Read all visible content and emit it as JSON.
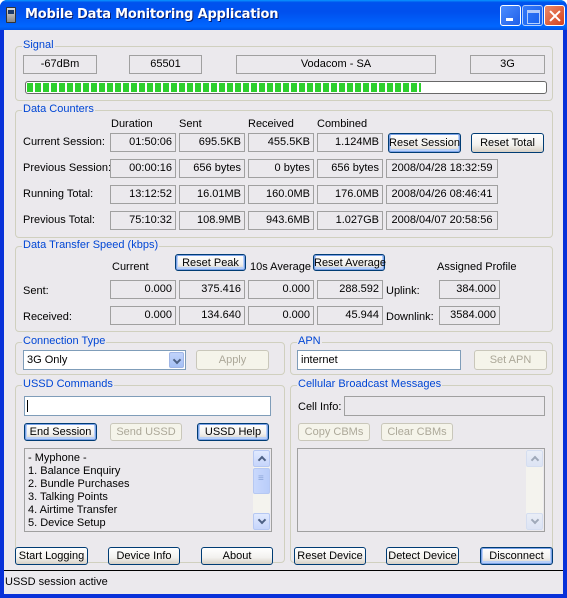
{
  "window": {
    "title": "Mobile Data Monitoring Application",
    "controls": [
      "minimize",
      "maximize",
      "close"
    ]
  },
  "signal": {
    "legend": "Signal",
    "strength": "-67dBm",
    "network_code": "65501",
    "operator": "Vodacom - SA",
    "technology": "3G",
    "signal_level_fraction": 0.76
  },
  "data_counters": {
    "legend": "Data Counters",
    "columns": [
      "Duration",
      "Sent",
      "Received",
      "Combined"
    ],
    "rows": [
      {
        "label": "Current Session:",
        "duration": "01:50:06",
        "sent": "695.5KB",
        "received": "455.5KB",
        "combined": "1.124MB"
      },
      {
        "label": "Previous Session:",
        "duration": "00:00:16",
        "sent": "656 bytes",
        "received": "0 bytes",
        "combined": "656 bytes",
        "timestamp": "2008/04/28 18:32:59"
      },
      {
        "label": "Running Total:",
        "duration": "13:12:52",
        "sent": "16.01MB",
        "received": "160.0MB",
        "combined": "176.0MB",
        "timestamp": "2008/04/26 08:46:41"
      },
      {
        "label": "Previous Total:",
        "duration": "75:10:32",
        "sent": "108.9MB",
        "received": "943.6MB",
        "combined": "1.027GB",
        "timestamp": "2008/04/07 20:58:56"
      }
    ],
    "reset_session_label": "Reset Session",
    "reset_total_label": "Reset Total"
  },
  "speed": {
    "legend": "Data Transfer Speed (kbps)",
    "current_label": "Current",
    "reset_peak_label": "Reset Peak",
    "average_label": "10s Average",
    "reset_average_label": "Reset Average",
    "assigned_profile_label": "Assigned Profile",
    "sent_label": "Sent:",
    "received_label": "Received:",
    "uplink_label": "Uplink:",
    "downlink_label": "Downlink:",
    "sent": {
      "current": "0.000",
      "peak": "375.416",
      "average": "0.000",
      "peak_average": "288.592",
      "profile": "384.000"
    },
    "received": {
      "current": "0.000",
      "peak": "134.640",
      "average": "0.000",
      "peak_average": "45.944",
      "profile": "3584.000"
    }
  },
  "connection": {
    "legend": "Connection Type",
    "selected": "3G Only",
    "apply_label": "Apply"
  },
  "apn": {
    "legend": "APN",
    "value": "internet",
    "set_label": "Set APN"
  },
  "ussd": {
    "legend": "USSD Commands",
    "input_value": "",
    "end_session_label": "End Session",
    "send_label": "Send USSD",
    "help_label": "USSD Help",
    "response_lines": [
      "- Myphone -",
      "1. Balance Enquiry",
      "2. Bundle Purchases",
      "3. Talking Points",
      "4. Airtime Transfer",
      "5. Device Setup"
    ]
  },
  "cbm": {
    "legend": "Cellular Broadcast Messages",
    "cell_info_label": "Cell Info:",
    "cell_info_value": "",
    "copy_label": "Copy CBMs",
    "clear_label": "Clear CBMs"
  },
  "bottom_buttons": {
    "start_logging": "Start Logging",
    "device_info": "Device Info",
    "about": "About",
    "reset_device": "Reset Device",
    "detect_device": "Detect Device",
    "disconnect": "Disconnect"
  },
  "status": {
    "text": "USSD session active"
  }
}
